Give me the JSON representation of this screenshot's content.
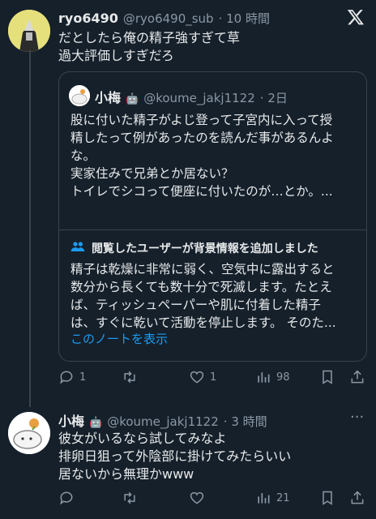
{
  "post1": {
    "name": "ryo6490",
    "handle": "@ryo6490_sub",
    "time": "· 10 時間",
    "text": "だとしたら俺の精子強すぎて草\n過大評価しすぎだろ"
  },
  "quote": {
    "name": "小梅",
    "handle": "@koume_jakj1122",
    "time": "· 2日",
    "text": "股に付いた精子がよじ登って子宮内に入って授\n精したって例があったのを読んだ事があるんよ\nな。\n実家住みで兄弟とか居ない？\nトイレでシコって便座に付いたのが…とか。..."
  },
  "note": {
    "title": "閲覧したユーザーが背景情報を追加しました",
    "text": "精子は乾燥に非常に弱く、空気中に露出すると\n数分から長くても数十分で死滅します。たとえ\nば、ティッシュペーパーや肌に付着した精子\nは、すぐに乾いて活動を停止します。 そのた...",
    "link": "このノートを表示"
  },
  "actions1": {
    "reply": "1",
    "retweet": "",
    "like": "1",
    "views": "98"
  },
  "post2": {
    "name": "小梅",
    "handle": "@koume_jakj1122",
    "time": "· 3 時間",
    "text": "彼女がいるなら試してみなよ\n排卵日狙って外陰部に掛けてみたらいい\n居ないから無理かwww"
  },
  "actions2": {
    "reply": "",
    "retweet": "",
    "like": "",
    "views": "21"
  },
  "colors": {
    "background": "#15202b",
    "text": "#e7e9ea",
    "muted": "#8b98a5",
    "link": "#1d9bf0"
  }
}
